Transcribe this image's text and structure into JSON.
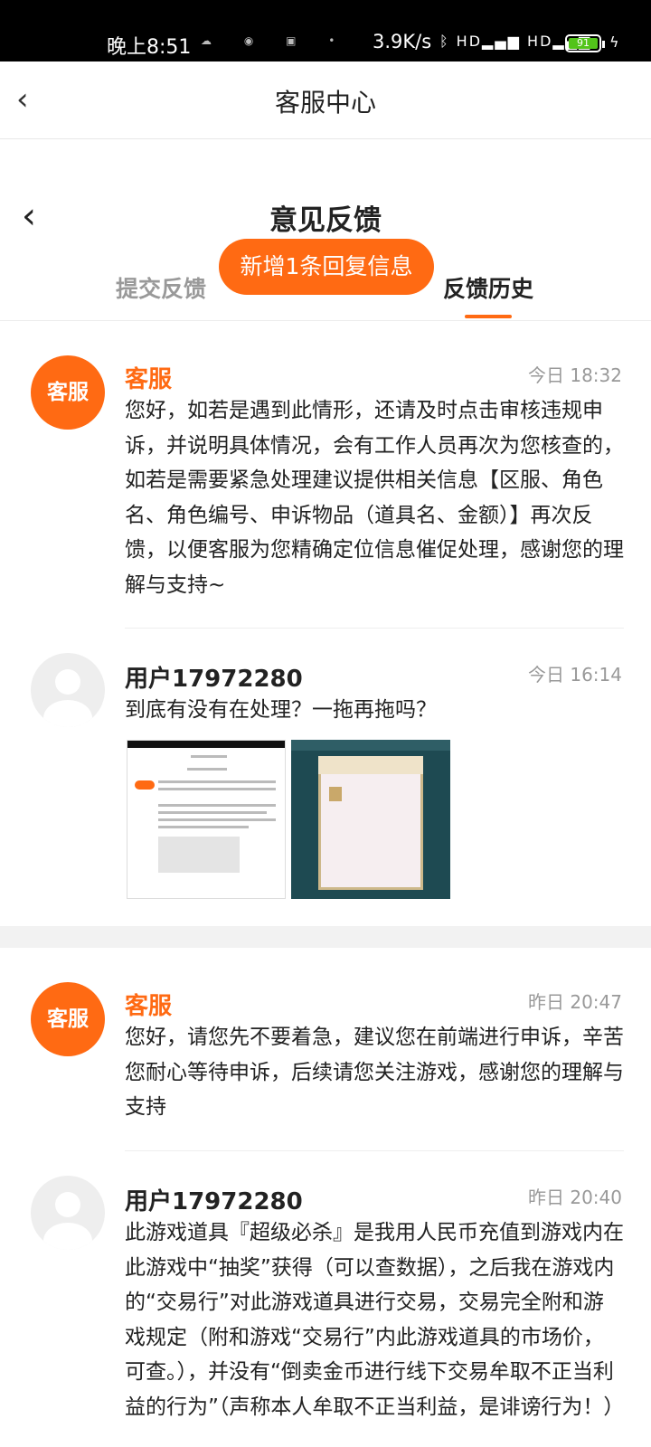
{
  "status_bar": {
    "time": "晚上8:51",
    "small_icons": "☁ ◉ ▣ •",
    "network_speed": "3.9K/s",
    "signal_icons": "ᛒ HD▂▄▆ HD▂▄▆",
    "battery": "91",
    "battery_color": "#52c41a"
  },
  "app_header": {
    "back_icon": "‹",
    "title": "客服中心"
  },
  "feedback": {
    "back_icon": "‹",
    "title": "意见反馈",
    "tabs": {
      "submit": "提交反馈",
      "history": "反馈历史"
    },
    "new_reply_badge": "新增1条回复信息"
  },
  "accent_color": "#ff6a13",
  "messages": [
    {
      "avatar_text": "客服",
      "sender": "客服",
      "time": "今日 18:32",
      "text": "您好，如若是遇到此情形，还请及时点击审核违规申诉，并说明具体情况，会有工作人员再次为您核查的，如若是需要紧急处理建议提供相关信息【区服、角色名、角色编号、申诉物品（道具名、金额）】再次反馈，以便客服为您精确定位信息催促处理，感谢您的理解与支持~"
    },
    {
      "sender": "用户17972280",
      "time": "今日 16:14",
      "text": "到底有没有在处理？一拖再拖吗？"
    },
    {
      "avatar_text": "客服",
      "sender": "客服",
      "time": "昨日 20:47",
      "text": "您好，请您先不要着急，建议您在前端进行申诉，辛苦您耐心等待申诉，后续请您关注游戏，感谢您的理解与支持"
    },
    {
      "sender": "用户17972280",
      "time": "昨日 20:40",
      "text": "此游戏道具『超级必杀』是我用人民币充值到游戏内在此游戏中“抽奖”获得（可以查数据），之后我在游戏内的“交易行”对此游戏道具进行交易，交易完全附和游戏规定（附和游戏“交易行”内此游戏道具的市场价，可查。），并没有“倒卖金币进行线下交易牟取不正当利益的行为”（声称本人牟取不正当利益，是诽谤行为！）"
    }
  ]
}
